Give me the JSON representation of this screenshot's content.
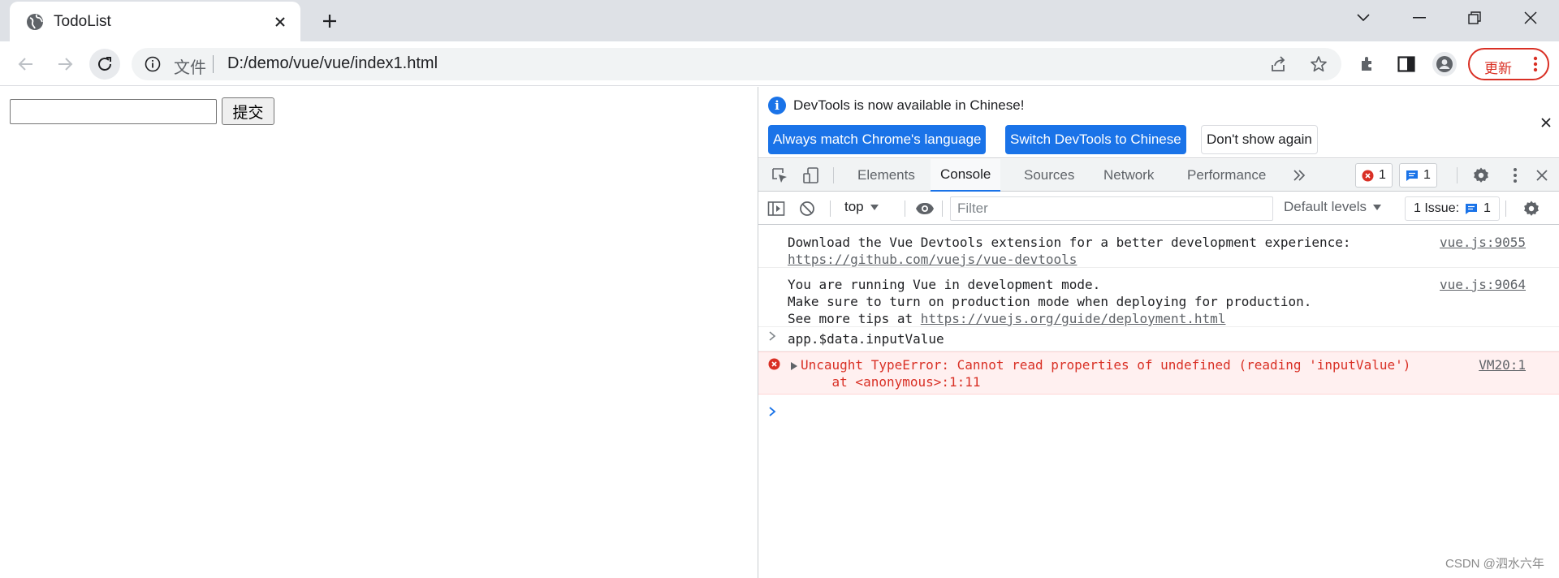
{
  "browser": {
    "tab_title": "TodoList",
    "omnibox": {
      "scheme_label": "文件",
      "url": "D:/demo/vue/vue/index1.html"
    },
    "update_label": "更新"
  },
  "page": {
    "input_value": "",
    "submit_label": "提交"
  },
  "devtools": {
    "infobar": {
      "message": "DevTools is now available in Chinese!",
      "btn_match": "Always match Chrome's language",
      "btn_switch": "Switch DevTools to Chinese",
      "btn_dismiss": "Don't show again"
    },
    "tabs": [
      "Elements",
      "Console",
      "Sources",
      "Network",
      "Performance"
    ],
    "active_tab": "Console",
    "error_count": "1",
    "message_count": "1",
    "console_bar": {
      "context": "top",
      "filter_placeholder": "Filter",
      "levels": "Default levels",
      "issues_label": "1 Issue:",
      "issues_count": "1"
    },
    "console": {
      "msg1_line1": "Download the Vue Devtools extension for a better development experience:",
      "msg1_link": "https://github.com/vuejs/vue-devtools",
      "msg1_src": "vue.js:9055",
      "msg2_line1": "You are running Vue in development mode.",
      "msg2_line2": "Make sure to turn on production mode when deploying for production.",
      "msg2_line3_prefix": "See more tips at ",
      "msg2_link": "https://vuejs.org/guide/deployment.html",
      "msg2_src": "vue.js:9064",
      "input_cmd": "app.$data.inputValue",
      "error_line1": "Uncaught TypeError: Cannot read properties of undefined (reading 'inputValue')",
      "error_line2": "    at <anonymous>:1:11",
      "error_src": "VM20:1"
    }
  },
  "watermark": "CSDN @泗水六年",
  "colors": {
    "accent": "#1a73e8",
    "error": "#d93025",
    "error_bg": "#fff0f0"
  }
}
